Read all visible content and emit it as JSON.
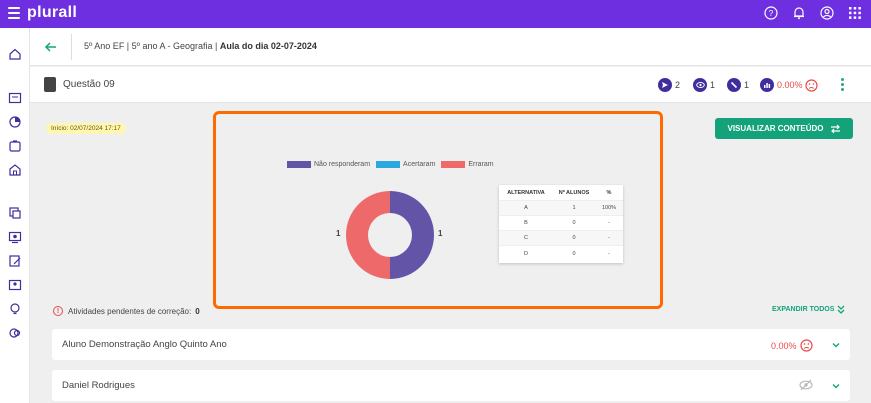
{
  "app": {
    "logo": "plurall"
  },
  "topbar": {
    "icons": [
      "help-icon",
      "bell-icon",
      "user-icon",
      "apps-grid-icon"
    ]
  },
  "sidebar": {
    "icons": [
      "home-icon",
      "classes-icon",
      "reports-icon",
      "tasks-icon",
      "school-icon",
      "content-icon",
      "activities-icon",
      "edit-icon",
      "gallery-icon",
      "ideas-icon",
      "integrations-icon"
    ]
  },
  "header": {
    "breadcrumb_prefix": "5º Ano EF | 5º ano A - Geografia |",
    "breadcrumb_current": "Aula do dia 02-07-2024"
  },
  "question": {
    "title": "Questão 09",
    "stats": {
      "sent": "2",
      "viewed": "1",
      "answered": "1",
      "accuracy": "0.00%"
    }
  },
  "start_badge": "Início: 02/07/2024 17:17",
  "view_button": "VISUALIZAR CONTEÚDO",
  "legend": {
    "not_answered": "Não responderam",
    "correct": "Acertaram",
    "wrong": "Erraram"
  },
  "colors": {
    "not_answered": "#6454a8",
    "correct": "#2aa8df",
    "wrong": "#ee6a6a",
    "accent": "#6e2fe0",
    "green": "#14a27a",
    "highlight": "#ff6a00"
  },
  "chart_data": {
    "type": "pie",
    "categories": [
      "Não responderam",
      "Acertaram",
      "Erraram"
    ],
    "values": [
      1,
      0,
      1
    ],
    "data_labels": [
      "1",
      "1"
    ]
  },
  "answers_table": {
    "headers": [
      "ALTERNATIVA",
      "Nº ALUNOS",
      "%"
    ],
    "rows": [
      [
        "A",
        "1",
        "100%"
      ],
      [
        "B",
        "0",
        "-"
      ],
      [
        "C",
        "0",
        "-"
      ],
      [
        "D",
        "0",
        "-"
      ]
    ]
  },
  "pending": {
    "label": "Atividades pendentes de correção:",
    "count": "0"
  },
  "expand_all": "EXPANDIR TODOS",
  "students": [
    {
      "name": "Aluno Demonstração Anglo Quinto Ano",
      "score": "0.00%"
    },
    {
      "name": "Daniel Rodrigues"
    }
  ]
}
